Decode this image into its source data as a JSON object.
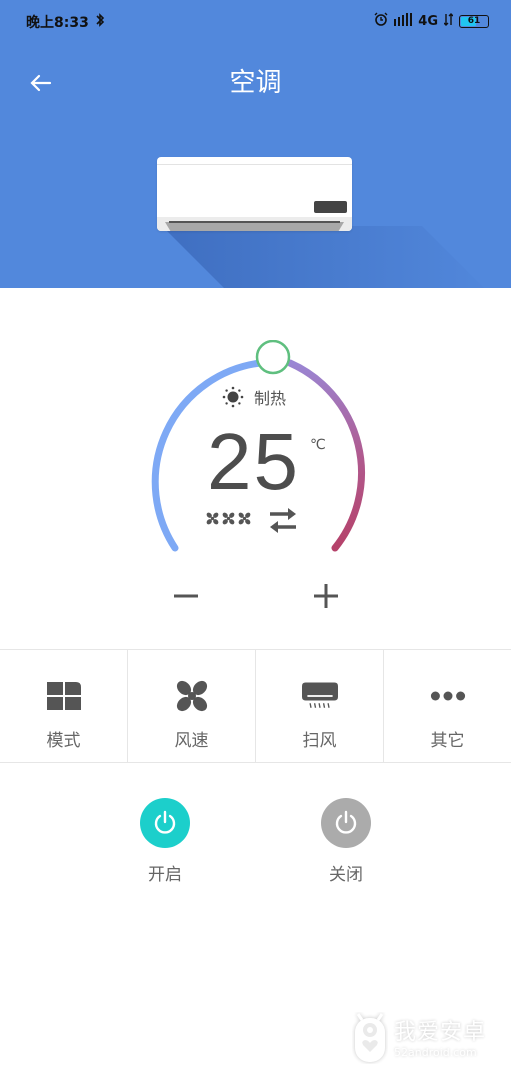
{
  "status_bar": {
    "time": "晚上8:33",
    "network": "4G",
    "battery": "61",
    "battery_level_percent": 61
  },
  "header": {
    "title": "空调"
  },
  "thermostat": {
    "mode_label": "制热",
    "mode_icon": "sun-icon",
    "temperature": "25",
    "unit": "℃",
    "fan_speed_level": 3,
    "swing_icon": "swap-arrows-icon",
    "colors": {
      "cool": "#7ea9f5",
      "heat": "#b5426a",
      "knob_border": "#5fbf7f"
    }
  },
  "controls": {
    "decrease_label": "−",
    "increase_label": "+"
  },
  "functions": [
    {
      "label": "模式",
      "icon": "mode-grid-icon"
    },
    {
      "label": "风速",
      "icon": "fan-icon"
    },
    {
      "label": "扫风",
      "icon": "ac-swing-icon"
    },
    {
      "label": "其它",
      "icon": "more-icon"
    }
  ],
  "power": {
    "on_label": "开启",
    "off_label": "关闭",
    "on_color": "#1ccfcb",
    "off_color": "#ababab"
  },
  "watermark": {
    "title": "我爱安卓",
    "subtitle": "52android.com"
  }
}
